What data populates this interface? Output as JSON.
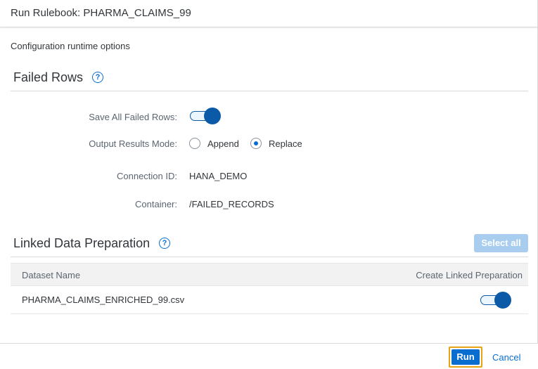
{
  "dialog": {
    "title": "Run Rulebook: PHARMA_CLAIMS_99",
    "subtitle": "Configuration runtime options"
  },
  "failed_rows": {
    "heading": "Failed Rows",
    "help_icon": "question-mark-circle-icon",
    "save_all_label": "Save All Failed Rows:",
    "save_all_enabled": true,
    "output_mode_label": "Output Results Mode:",
    "output_mode_options": [
      {
        "label": "Append",
        "selected": false
      },
      {
        "label": "Replace",
        "selected": true
      }
    ],
    "connection_label": "Connection ID:",
    "connection_value": "HANA_DEMO",
    "container_label": "Container:",
    "container_value": "/FAILED_RECORDS"
  },
  "linked_prep": {
    "heading": "Linked Data Preparation",
    "help_icon": "question-mark-circle-icon",
    "select_all_label": "Select all",
    "columns": [
      "Dataset Name",
      "Create Linked Preparation"
    ],
    "rows": [
      {
        "dataset_name": "PHARMA_CLAIMS_ENRICHED_99.csv",
        "create_linked": true
      }
    ]
  },
  "footer": {
    "run_label": "Run",
    "cancel_label": "Cancel"
  },
  "colors": {
    "accent": "#0a6ed1",
    "toggle_on": "#0a5aa8",
    "focus_outline": "#e8a417",
    "disabled_button": "#a9cdee"
  }
}
